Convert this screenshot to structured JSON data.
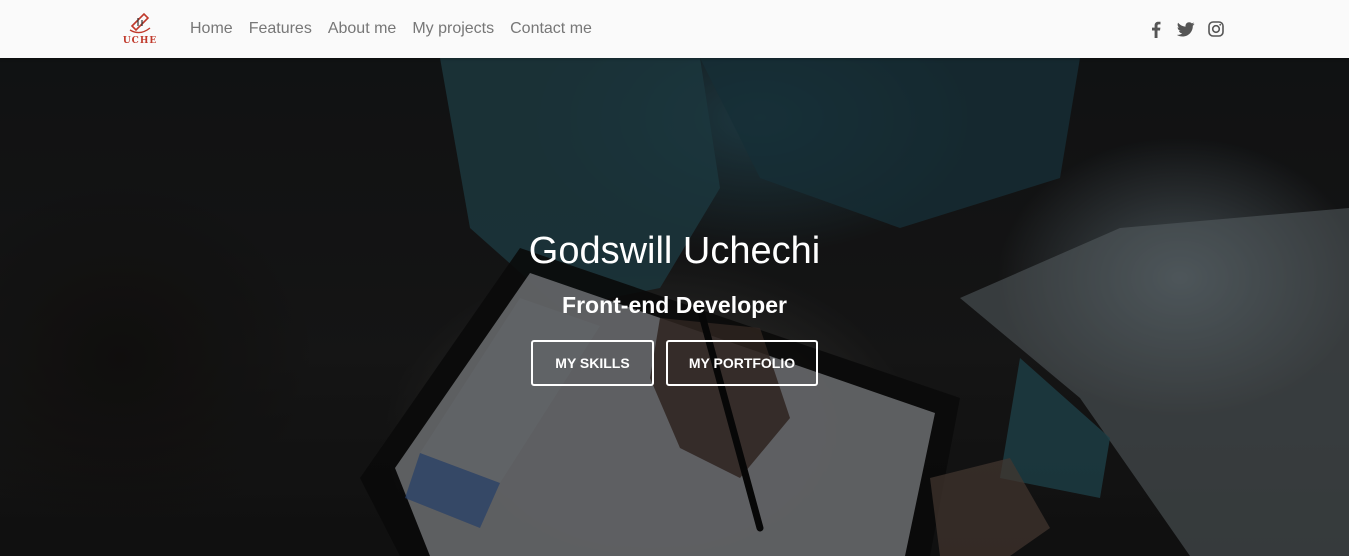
{
  "brand": {
    "logo_text": "UCHE",
    "logo_color": "#c0392b"
  },
  "nav": {
    "links": [
      {
        "label": "Home"
      },
      {
        "label": "Features"
      },
      {
        "label": "About me"
      },
      {
        "label": "My projects"
      },
      {
        "label": "Contact me"
      }
    ]
  },
  "social": {
    "icons": [
      "facebook-icon",
      "twitter-icon",
      "instagram-icon"
    ],
    "icon_color": "#555555"
  },
  "hero": {
    "title": "Godswill Uchechi",
    "subtitle": "Front-end Developer",
    "buttons": {
      "skills": "MY SKILLS",
      "portfolio": "MY PORTFOLIO"
    }
  }
}
